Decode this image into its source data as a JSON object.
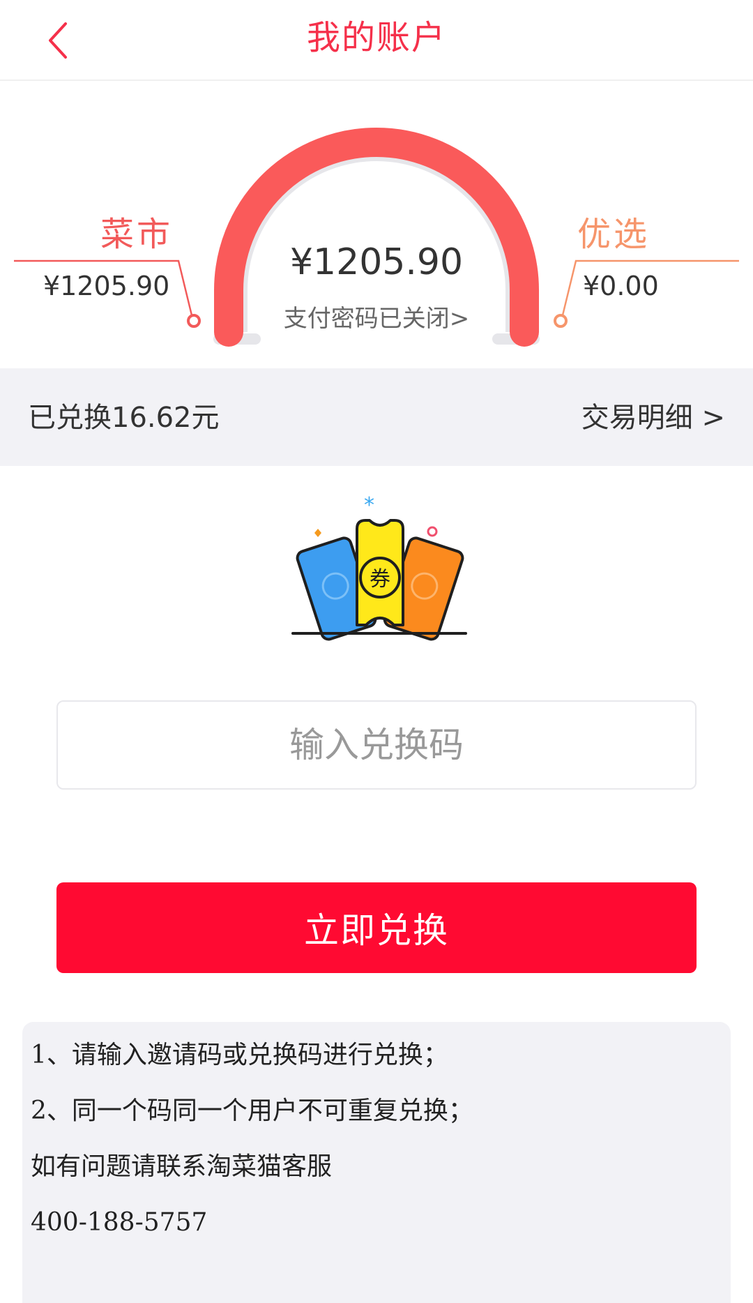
{
  "header": {
    "title": "我的账户",
    "back_icon": "chevron-left-icon"
  },
  "gauge": {
    "total": "¥1205.90",
    "pay_password_link": "支付密码已关闭>",
    "left": {
      "label": "菜市",
      "amount": "¥1205.90"
    },
    "right": {
      "label": "优选",
      "amount": "¥0.00"
    },
    "colors": {
      "arc": "#fa5a5a",
      "track": "#e6e6ea",
      "left_accent": "#f25a5a",
      "right_accent": "#f6956b"
    }
  },
  "info_bar": {
    "redeemed": "已兑换16.62元",
    "details_link": "交易明细 >"
  },
  "illustration": {
    "icon": "coupon-tickets-icon",
    "ticket_text": "券"
  },
  "redeem": {
    "placeholder": "输入兑换码",
    "value": "",
    "button_label": "立即兑换",
    "button_color": "#ff0a32"
  },
  "notes": {
    "line1": "1、请输入邀请码或兑换码进行兑换；",
    "line2": "2、同一个码同一个用户不可重复兑换；",
    "line3": "如有问题请联系淘菜猫客服",
    "line4": "400-188-5757"
  }
}
